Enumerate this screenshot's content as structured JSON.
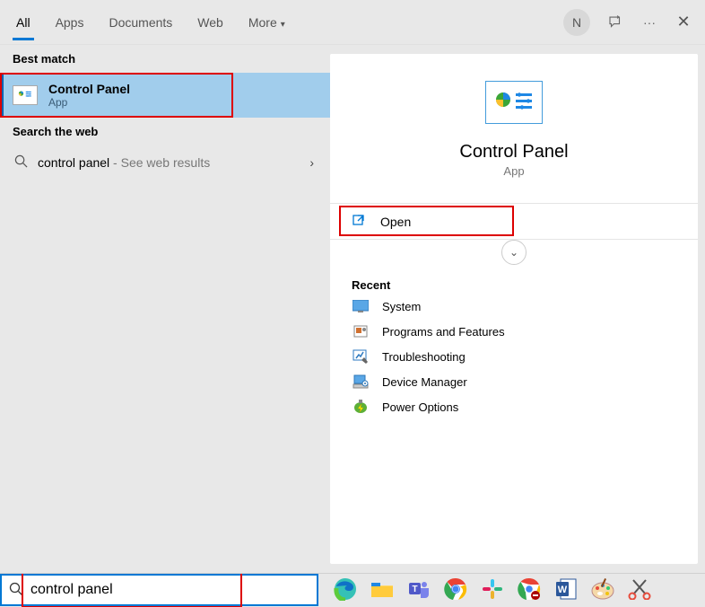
{
  "header": {
    "tabs": [
      "All",
      "Apps",
      "Documents",
      "Web",
      "More"
    ],
    "avatar_letter": "N"
  },
  "left": {
    "best_match_label": "Best match",
    "best_match": {
      "title": "Control Panel",
      "subtitle": "App"
    },
    "search_web_label": "Search the web",
    "web_row": {
      "query": "control panel",
      "hint": " - See web results"
    }
  },
  "right": {
    "title": "Control Panel",
    "subtitle": "App",
    "open_label": "Open",
    "recent_label": "Recent",
    "recent_items": [
      {
        "label": "System"
      },
      {
        "label": "Programs and Features"
      },
      {
        "label": "Troubleshooting"
      },
      {
        "label": "Device Manager"
      },
      {
        "label": "Power Options"
      }
    ]
  },
  "search": {
    "value": "control panel"
  }
}
